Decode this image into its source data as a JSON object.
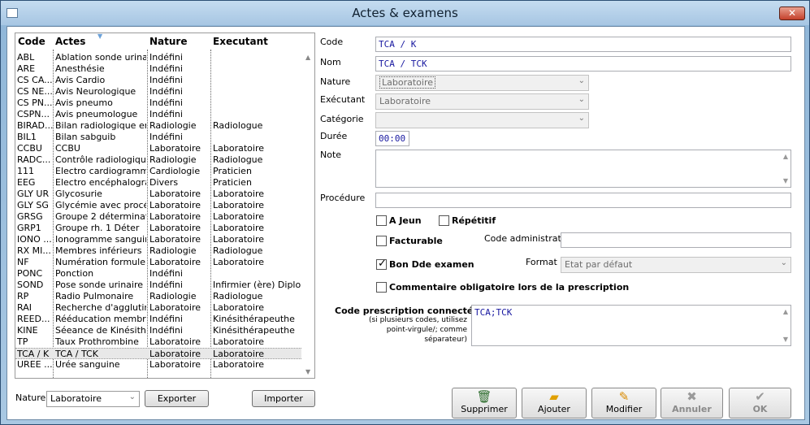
{
  "window": {
    "title": "Actes & examens",
    "close_glyph": "✕"
  },
  "list": {
    "headers": {
      "code": "Code",
      "actes": "Actes",
      "nature": "Nature",
      "executant": "Executant"
    },
    "rows": [
      [
        "ABL",
        "Ablation sonde urinaire",
        "Indéfini",
        ""
      ],
      [
        "ARE",
        "Anesthésie",
        "Indéfini",
        ""
      ],
      [
        "CS CA...",
        "Avis Cardio",
        "Indéfini",
        ""
      ],
      [
        "CS NE...",
        "Avis Neurologique",
        "Indéfini",
        ""
      ],
      [
        "CS PN...",
        "Avis pneumo",
        "Indéfini",
        ""
      ],
      [
        "CSPN...",
        "Avis pneumologue",
        "Indéfini",
        ""
      ],
      [
        "BIRAD...",
        "Bilan radiologique ent...",
        "Radiologie",
        "Radiologue"
      ],
      [
        "BIL1",
        "Bilan sabguib",
        "Indéfini",
        ""
      ],
      [
        "CCBU",
        "CCBU",
        "Laboratoire",
        "Laboratoire"
      ],
      [
        "RADC...",
        "Contrôle radiologique",
        "Radiologie",
        "Radiologue"
      ],
      [
        "111",
        "Electro cardiogramme",
        "Cardiologie",
        "Praticien"
      ],
      [
        "EEG",
        "Electro encéphalogra...",
        "Divers",
        "Praticien"
      ],
      [
        "GLY UR",
        "Glycosurie",
        "Laboratoire",
        "Laboratoire"
      ],
      [
        "GLY SG",
        "Glycémie avec procé...",
        "Laboratoire",
        "Laboratoire"
      ],
      [
        "GRSG",
        "Groupe 2 déterminati...",
        "Laboratoire",
        "Laboratoire"
      ],
      [
        "GRP1",
        "Groupe rh. 1 Déter",
        "Laboratoire",
        "Laboratoire"
      ],
      [
        "IONO ...",
        "Ionogramme sanguin",
        "Laboratoire",
        "Laboratoire"
      ],
      [
        "RX MI...",
        "Membres inférieurs",
        "Radiologie",
        "Radiologue"
      ],
      [
        "NF",
        "Numération formule",
        "Laboratoire",
        "Laboratoire"
      ],
      [
        "PONC",
        "Ponction",
        "Indéfini",
        ""
      ],
      [
        "SOND",
        "Pose sonde urinaire",
        "Indéfini",
        "Infirmier (ère) Diplom..."
      ],
      [
        "RP",
        "Radio Pulmonaire",
        "Radiologie",
        "Radiologue"
      ],
      [
        "RAI",
        "Recherche d'agglutin...",
        "Laboratoire",
        "Laboratoire"
      ],
      [
        "REED...",
        "Rééducation membre...",
        "Indéfini",
        "Kinésithérapeuthe"
      ],
      [
        "KINE",
        "Séeance de Kinésith...",
        "Indéfini",
        "Kinésithérapeuthe"
      ],
      [
        "TP",
        "Taux Prothrombine",
        "Laboratoire",
        "Laboratoire"
      ],
      [
        "TCA / K",
        "TCA / TCK",
        "Laboratoire",
        "Laboratoire"
      ],
      [
        "UREE ...",
        "Urée sanguine",
        "Laboratoire",
        "Laboratoire"
      ]
    ],
    "selected_index": 26
  },
  "filter": {
    "label": "Nature",
    "value": "Laboratoire",
    "export_label": "Exporter",
    "import_label": "Importer"
  },
  "form": {
    "code_label": "Code",
    "code_value": "TCA / K",
    "nom_label": "Nom",
    "nom_value": "TCA / TCK",
    "nature_label": "Nature",
    "nature_value": "Laboratoire",
    "executant_label": "Exécutant",
    "executant_value": "Laboratoire",
    "categorie_label": "Catégorie",
    "categorie_value": "",
    "duree_label": "Durée",
    "duree_value": "00:00",
    "note_label": "Note",
    "note_value": "",
    "procedure_label": "Procédure",
    "procedure_value": "",
    "a_jeun_label": "A Jeun",
    "a_jeun_checked": false,
    "repetitif_label": "Répétitif",
    "repetitif_checked": false,
    "facturable_label": "Facturable",
    "facturable_checked": false,
    "code_admin_label": "Code administratif",
    "code_admin_value": "",
    "bon_label": "Bon Dde examen",
    "bon_checked": true,
    "format_label": "Format",
    "format_value": "Etat par défaut",
    "commentaire_label": "Commentaire obligatoire lors de la prescription",
    "commentaire_checked": false,
    "code_presc_label": "Code prescription connectée",
    "code_presc_help_1": "(si plusieurs codes, utilisez",
    "code_presc_help_2": "point-virgule/; comme",
    "code_presc_help_3": "séparateur)",
    "code_presc_value": "TCA;TCK"
  },
  "buttons": {
    "supprimer": "Supprimer",
    "ajouter": "Ajouter",
    "modifier": "Modifier",
    "annuler": "Annuler",
    "ok": "OK"
  },
  "icons": {
    "supprimer": "trash-icon",
    "ajouter": "folder-add-icon",
    "modifier": "pencil-icon",
    "annuler": "cross-icon",
    "ok": "checkmark-icon"
  },
  "colors": {
    "field_text": "#1818a0",
    "titlebar": "#c5dcf0"
  }
}
